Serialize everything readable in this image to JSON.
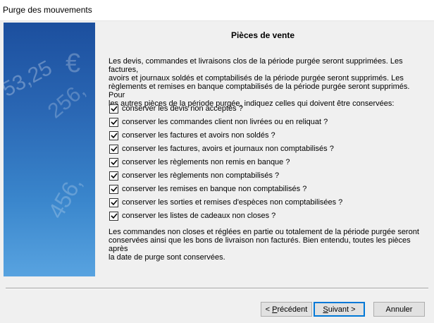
{
  "window": {
    "title": "Purge des mouvements"
  },
  "side_panel": {
    "decor_numbers": [
      "53,25",
      "€",
      "256,",
      "456,"
    ]
  },
  "page": {
    "title": "Pièces de vente",
    "intro_lines": [
      "Les devis, commandes et livraisons clos de la période purgée seront supprimées. Les factures,",
      "avoirs et journaux soldés et comptabilisés de la période purgée seront supprimés. Les",
      "règlements et remises en banque comptabilisés de la période purgée seront supprimés. Pour",
      "les autres pièces de la période purgée, indiquez celles qui doivent être conservées:"
    ],
    "options": [
      {
        "label": "conserver les devis non acceptés ?",
        "checked": true
      },
      {
        "label": "conserver les commandes client non livrées ou en reliquat ?",
        "checked": true
      },
      {
        "label": "conserver les factures et avoirs non soldés ?",
        "checked": true
      },
      {
        "label": "conserver les factures, avoirs et journaux non comptabilisés ?",
        "checked": true
      },
      {
        "label": "conserver les règlements non remis en banque ?",
        "checked": true
      },
      {
        "label": "conserver les règlements non comptabilisés ?",
        "checked": true
      },
      {
        "label": "conserver les remises en banque non comptabilisés ?",
        "checked": true
      },
      {
        "label": "conserver les sorties et remises d'espèces non comptabilisées ?",
        "checked": true
      },
      {
        "label": "conserver les listes de cadeaux non closes ?",
        "checked": true
      }
    ],
    "outro_lines": [
      "Les commandes non closes et réglées en partie ou totalement de la période purgée seront",
      "conservées ainsi que les bons de livraison non facturés. Bien entendu, toutes les pièces après",
      "la date de purge sont conservées."
    ]
  },
  "buttons": {
    "back": {
      "prefix": "< ",
      "mnemonic": "P",
      "rest": "récédent"
    },
    "next": {
      "mnemonic": "S",
      "rest": "uivant",
      "suffix": " >"
    },
    "cancel": {
      "label": "Annuler"
    }
  }
}
